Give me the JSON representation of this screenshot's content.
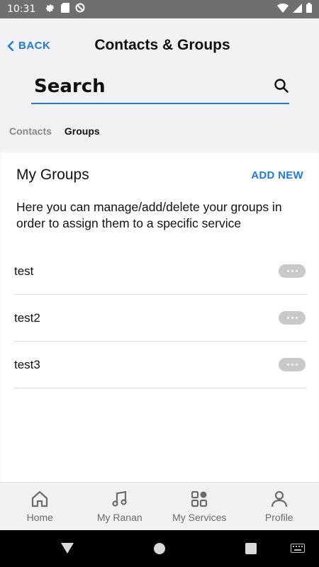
{
  "status_bar": {
    "time": "10:31",
    "left_icons": [
      "gear-icon",
      "sd-card-icon",
      "do-not-disturb-icon"
    ],
    "right_icons": [
      "wifi-icon",
      "cellular-icon",
      "battery-icon"
    ]
  },
  "header": {
    "back_label": "BACK",
    "title": "Contacts & Groups",
    "search_placeholder": "Search",
    "tabs": [
      {
        "label": "Contacts",
        "active": false
      },
      {
        "label": "Groups",
        "active": true
      }
    ]
  },
  "groups": {
    "title": "My Groups",
    "add_new_label": "ADD NEW",
    "description": "Here you can manage/add/delete your groups in order to assign them to a specific service",
    "items": [
      {
        "name": "test"
      },
      {
        "name": "test2"
      },
      {
        "name": "test3"
      }
    ]
  },
  "bottom_nav": {
    "items": [
      {
        "label": "Home",
        "icon": "home-icon"
      },
      {
        "label": "My Ranan",
        "icon": "music-note-icon"
      },
      {
        "label": "My Services",
        "icon": "grid-icon"
      },
      {
        "label": "Profile",
        "icon": "profile-icon"
      }
    ]
  },
  "colors": {
    "accent": "#1f7ae0",
    "header_bg": "#f2f2f5",
    "status_bar": "#6f6f6f"
  }
}
